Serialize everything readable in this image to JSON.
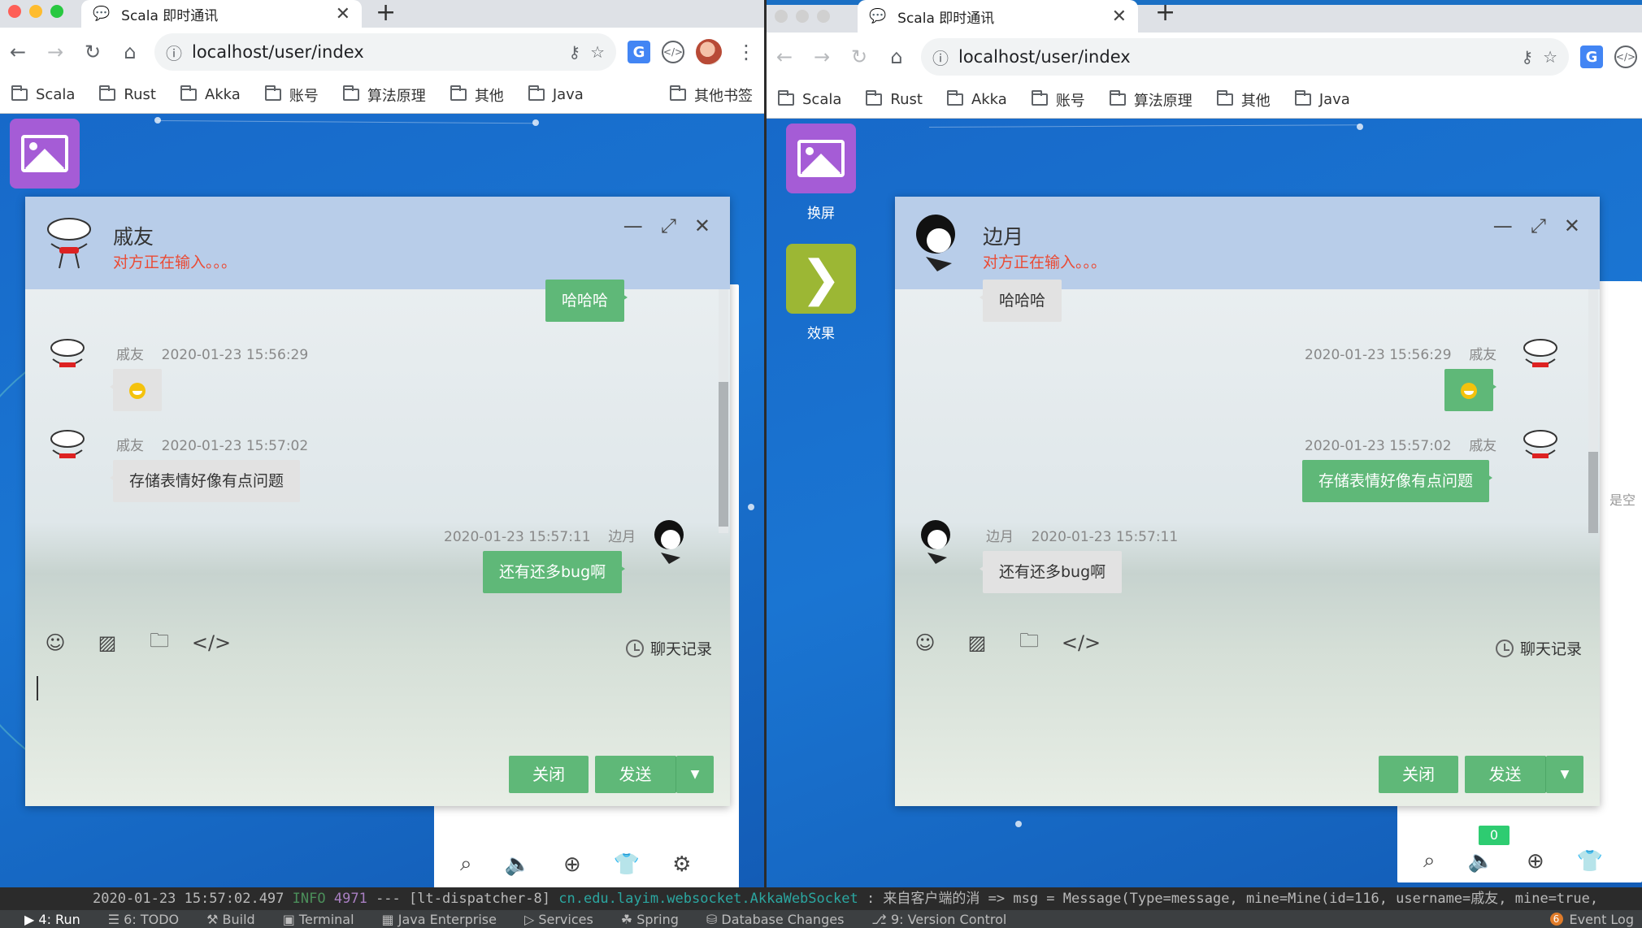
{
  "colors": {
    "accent": "#5fb878",
    "typing": "#ea4b35",
    "header": "#b8cde9"
  },
  "browser": {
    "tab_title": "Scala 即时通讯",
    "url": "localhost/user/index",
    "bookmarks": [
      "Scala",
      "Rust",
      "Akka",
      "账号",
      "算法原理",
      "其他",
      "Java"
    ],
    "other_bookmarks": "其他书签"
  },
  "desktop": {
    "swap_label": "换屏",
    "effect_label": "效果",
    "right_partial_text": "是空",
    "badge": "0"
  },
  "left_chat": {
    "name": "戚友",
    "status": "对方正在输入。。。",
    "top_bubble": "哈哈哈",
    "messages": [
      {
        "sender": "戚友",
        "time": "2020-01-23 15:56:29",
        "text": ""
      },
      {
        "sender": "戚友",
        "time": "2020-01-23 15:57:02",
        "text": "存储表情好像有点问题"
      },
      {
        "sender": "边月",
        "time": "2020-01-23 15:57:11",
        "text": "还有还多bug啊"
      }
    ]
  },
  "right_chat": {
    "name": "边月",
    "status": "对方正在输入。。。",
    "top_bubble": "哈哈哈",
    "messages": [
      {
        "sender": "戚友",
        "time": "2020-01-23 15:56:29",
        "text": ""
      },
      {
        "sender": "戚友",
        "time": "2020-01-23 15:57:02",
        "text": "存储表情好像有点问题"
      },
      {
        "sender": "边月",
        "time": "2020-01-23 15:57:11",
        "text": "还有还多bug啊"
      }
    ]
  },
  "chat_ui": {
    "history": "聊天记录",
    "close": "关闭",
    "send": "发送"
  },
  "log": {
    "timestamp": "2020-01-23 15:57:02.497",
    "level": "INFO",
    "pid": "4971",
    "thread": "--- [lt-dispatcher-8]",
    "logger": "cn.edu.layim.websocket.AkkaWebSocket",
    "message": "    : 来自客户端的消  => msg = Message(Type=message, mine=Mine(id=116, username=戚友, mine=true,"
  },
  "ide": {
    "tabs": [
      "4: Run",
      "6: TODO",
      "Build",
      "Terminal",
      "Java Enterprise",
      "Services",
      "Spring",
      "Database Changes",
      "9: Version Control"
    ],
    "event_log": "Event Log",
    "event_count": "6"
  }
}
